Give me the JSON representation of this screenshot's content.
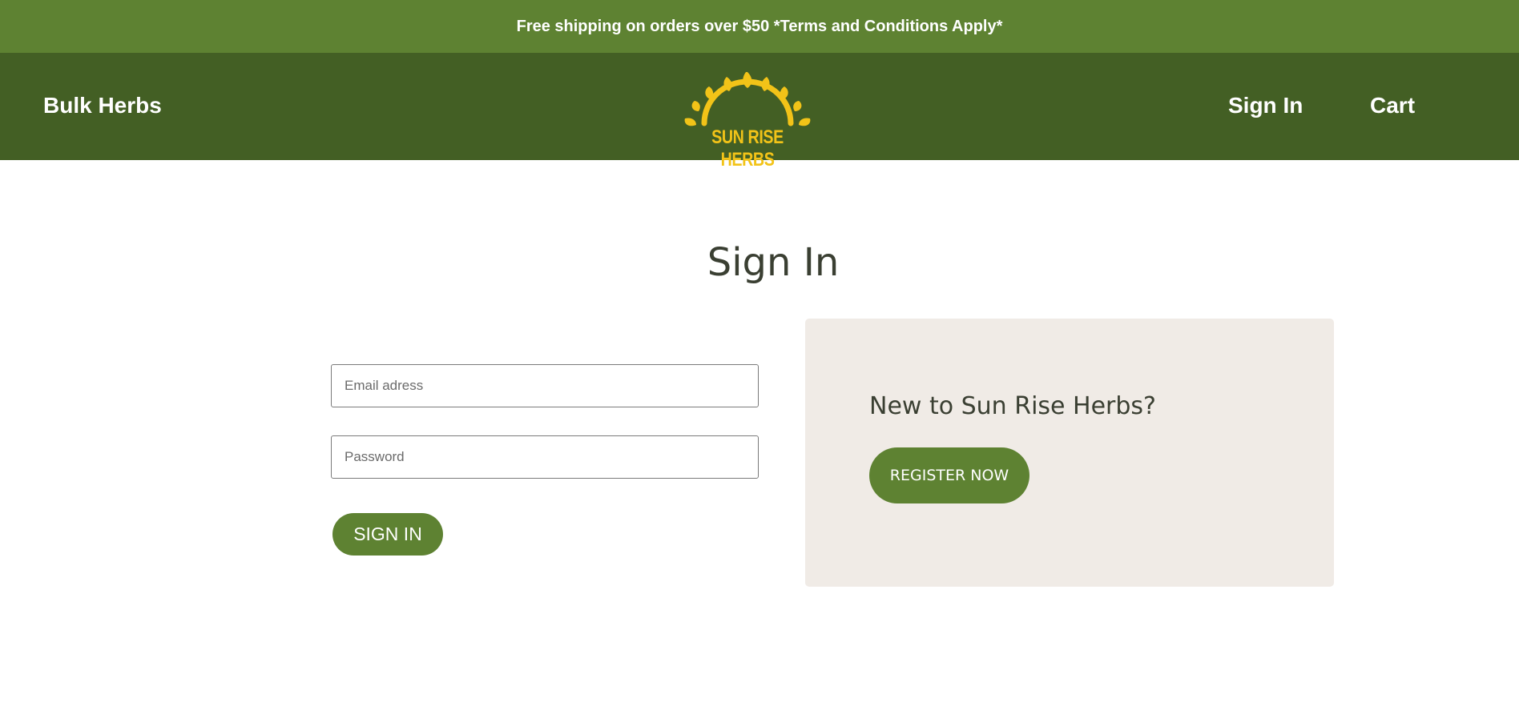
{
  "promo": {
    "text": "Free shipping on orders over $50 *Terms and Conditions Apply*"
  },
  "header": {
    "nav_left_label": "Bulk Herbs",
    "logo_text": "SUN RISE HERBS",
    "signin_label": "Sign In",
    "cart_label": "Cart"
  },
  "main": {
    "title": "Sign In",
    "form": {
      "email_placeholder": "Email adress",
      "email_value": "",
      "password_placeholder": "Password",
      "password_value": "",
      "submit_label": "SIGN IN"
    },
    "register": {
      "heading": "New to Sun Rise Herbs?",
      "button_label": "REGISTER NOW"
    }
  },
  "colors": {
    "promo_bar": "#5e8232",
    "header": "#435f24",
    "logo": "#f2c318",
    "button": "#5e8232",
    "panel": "#f0ebe6",
    "heading_text": "#3a3f32"
  }
}
